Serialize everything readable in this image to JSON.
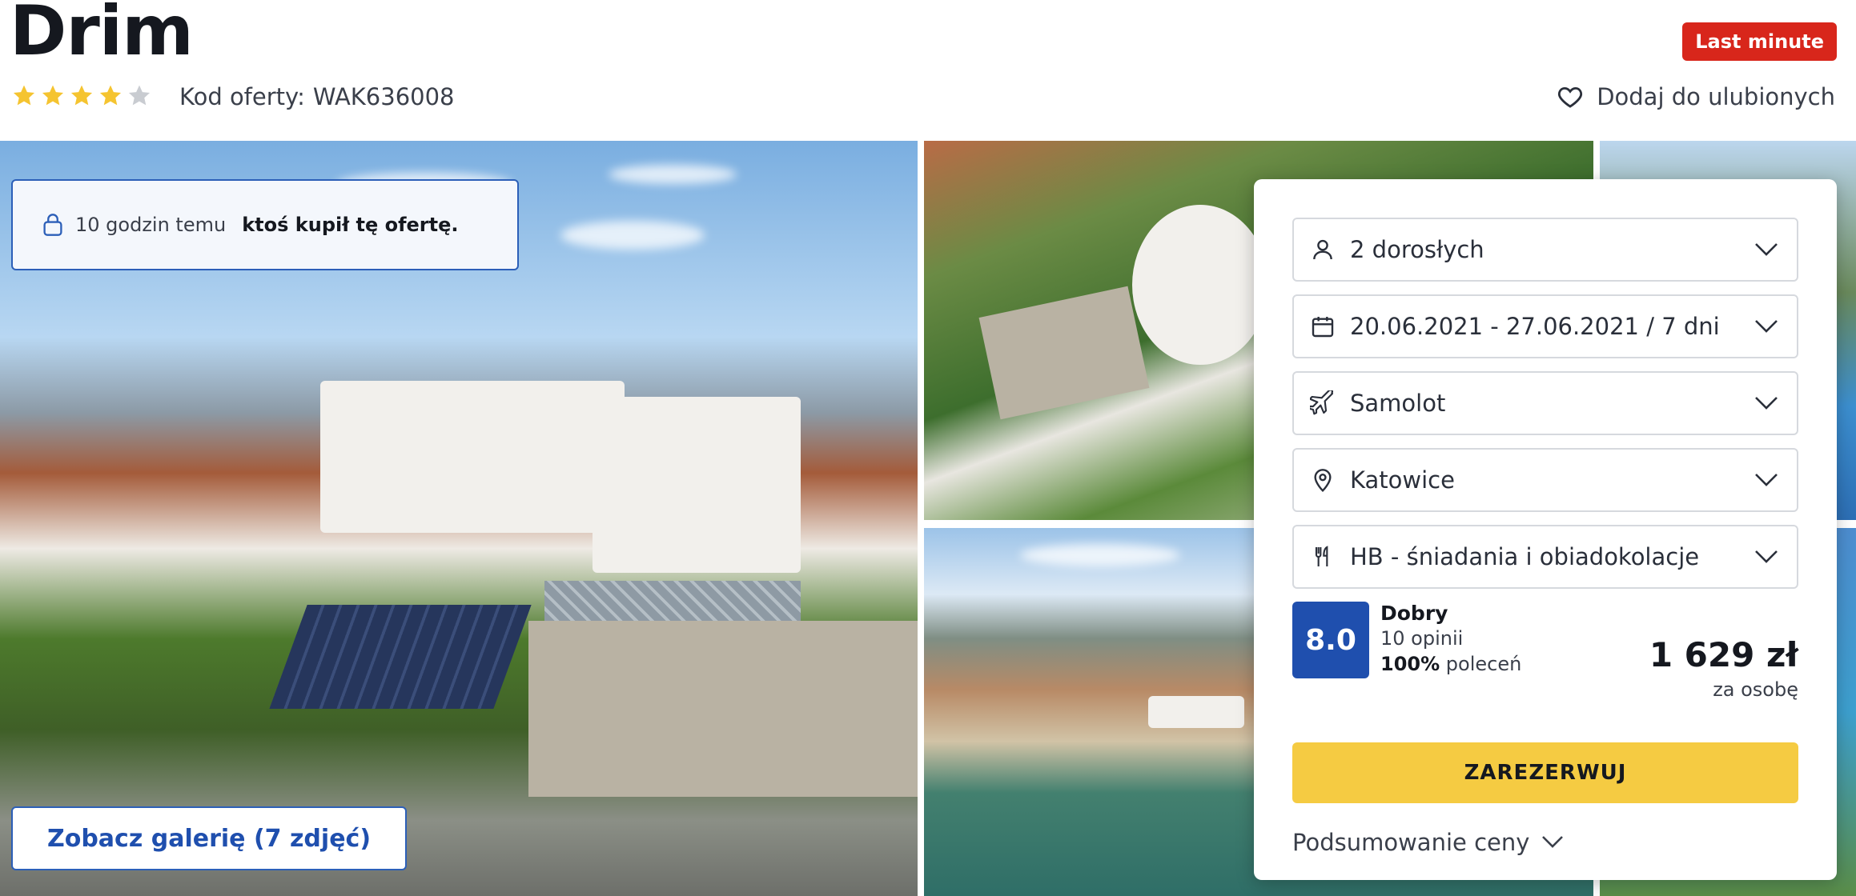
{
  "header": {
    "title": "Drim",
    "stars_filled": 4,
    "stars_total": 5,
    "offer_code_label": "Kod oferty:",
    "offer_code": "WAK636008",
    "badge": "Last minute",
    "favorite_label": "Dodaj do ulubionych"
  },
  "gallery": {
    "notice_time": "10 godzin temu",
    "notice_text": "ktoś kupił tę ofertę.",
    "button_label": "Zobacz galerię (7 zdjęć)"
  },
  "booking": {
    "travelers": "2 dorosłych",
    "dates": "20.06.2021 - 27.06.2021 / 7 dni",
    "transport": "Samolot",
    "departure": "Katowice",
    "board": "HB - śniadania i obiadokolacje",
    "rating_score": "8.0",
    "rating_label": "Dobry",
    "rating_count": "10 opinii",
    "rating_recommend_pct": "100%",
    "rating_recommend_label": "poleceń",
    "price": "1 629 zł",
    "price_unit": "za osobę",
    "reserve_label": "ZAREZERWUJ",
    "summary_label": "Podsumowanie ceny"
  },
  "colors": {
    "accent_blue": "#1f4fae",
    "badge_red": "#d8261b",
    "reserve_yellow": "#f5cb42",
    "star_yellow": "#f5c430",
    "star_grey": "#c9ccd1"
  },
  "icons": {
    "travelers": "person-icon",
    "dates": "calendar-icon",
    "transport": "airplane-icon",
    "departure": "location-pin-icon",
    "board": "cutlery-icon",
    "favorite": "heart-icon",
    "notice": "lock-icon"
  }
}
